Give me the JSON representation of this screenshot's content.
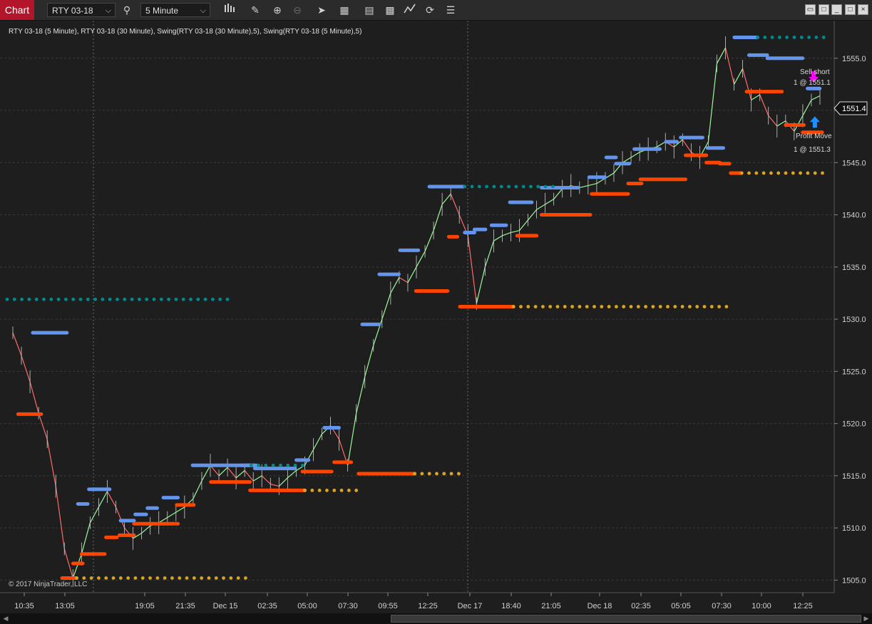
{
  "toolbar": {
    "tab_label": "Chart",
    "instrument": "RTY 03-18",
    "interval": "5 Minute",
    "icons": [
      "bars-type-icon",
      "pencil-icon",
      "zoom-in-icon",
      "zoom-out-icon",
      "pointer-icon",
      "data-box-icon",
      "layers-icon",
      "strategy-icon",
      "refresh-icon",
      "properties-icon"
    ],
    "window_icons": [
      "restore-icon",
      "maximize-icon",
      "minimize-icon",
      "window-icon",
      "close-icon"
    ]
  },
  "chart": {
    "legend_text": "RTY 03-18 (5 Minute), RTY 03-18 (30 Minute), Swing(RTY 03-18 (30 Minute),5), Swing(RTY 03-18 (5 Minute),5)",
    "copyright": "© 2017 NinjaTrader, LLC",
    "last_price_label": "1551.4",
    "annotations": [
      {
        "text": "Sell short",
        "kind": "entry"
      },
      {
        "text": "1 @ 1551.1",
        "kind": "entry-price"
      },
      {
        "text": "Profit Move",
        "kind": "exit"
      },
      {
        "text": "1 @ 1551.3",
        "kind": "exit-price"
      }
    ],
    "colors": {
      "background": "#1e1e1e",
      "grid": "#3a3a3a",
      "swing_high": "#6495ed",
      "swing_low": "#ff4500",
      "swing_high_dots": "#008b8b",
      "swing_low_dots": "#daa520",
      "candle_up": "#98fb98",
      "candle_down": "#ff6a6a",
      "sell_arrow": "#ff00ff",
      "buy_arrow": "#1e90ff"
    }
  },
  "chart_data": {
    "type": "line",
    "title": "",
    "x_tick_labels": [
      "10:35",
      "13:05",
      "19:05",
      "21:35",
      "Dec 15",
      "02:35",
      "05:00",
      "07:30",
      "09:55",
      "12:25",
      "Dec 17",
      "18:40",
      "21:05",
      "Dec 18",
      "02:35",
      "05:05",
      "07:30",
      "10:00",
      "12:25"
    ],
    "y_tick_labels": [
      "1505.0",
      "1510.0",
      "1515.0",
      "1520.0",
      "1525.0",
      "1530.0",
      "1535.0",
      "1540.0",
      "1545.0",
      "1550.0",
      "1555.0"
    ],
    "ylim": [
      1503.8,
      1558.6
    ],
    "series": [
      {
        "values_approx": [
          1528.7,
          1526.5,
          1524.0,
          1521.0,
          1518.5,
          1514.0,
          1508.0,
          1505.2,
          1507.5,
          1510.5,
          1512.0,
          1513.5,
          1512.0,
          1510.0,
          1509.0,
          1509.5,
          1510.2,
          1510.5,
          1511.0,
          1511.5,
          1512.0,
          1512.8,
          1514.5,
          1516.0,
          1515.0,
          1515.8,
          1514.8,
          1515.5,
          1514.5,
          1515.0,
          1514.2,
          1514.0,
          1514.8,
          1515.5,
          1516.0,
          1517.5,
          1519.0,
          1519.8,
          1518.5,
          1516.0,
          1521.0,
          1524.5,
          1527.5,
          1530.0,
          1532.5,
          1534.0,
          1533.5,
          1535.0,
          1536.5,
          1538.5,
          1541.0,
          1542.0,
          1540.0,
          1538.0,
          1531.5,
          1535.0,
          1537.5,
          1538.0,
          1538.3,
          1538.5,
          1539.5,
          1540.5,
          1541.0,
          1541.5,
          1542.5,
          1542.8,
          1542.6,
          1542.8,
          1543.0,
          1543.5,
          1544.0,
          1545.0,
          1545.5,
          1546.0,
          1546.3,
          1546.5,
          1547.0,
          1546.5,
          1547.2,
          1546.0,
          1545.5,
          1547.0,
          1554.5,
          1556.0,
          1552.5,
          1554.0,
          1551.0,
          1551.5,
          1549.5,
          1548.5,
          1549.0,
          1548.0,
          1549.5,
          1551.0,
          1551.4
        ]
      }
    ],
    "swing_highs": [
      {
        "x0": 10.5,
        "x1": 24.5,
        "y": 1528.7
      },
      {
        "x0": 29.0,
        "x1": 33.0,
        "y": 1512.3
      },
      {
        "x0": 33.5,
        "x1": 42.0,
        "y": 1513.7
      },
      {
        "x0": 46.5,
        "x1": 52.0,
        "y": 1510.7
      },
      {
        "x0": 52.5,
        "x1": 57.0,
        "y": 1511.3
      },
      {
        "x0": 57.5,
        "x1": 61.5,
        "y": 1511.9
      },
      {
        "x0": 64.0,
        "x1": 70.0,
        "y": 1512.9
      },
      {
        "x0": 76.0,
        "x1": 100.0,
        "y": 1516.0
      },
      {
        "x0": 96.0,
        "x1": 102.0,
        "y": 1516.0
      },
      {
        "x0": 101.5,
        "x1": 118.0,
        "y": 1515.7
      },
      {
        "x0": 118.5,
        "x1": 123.5,
        "y": 1516.5
      },
      {
        "x0": 130.0,
        "x1": 136.0,
        "y": 1519.6
      },
      {
        "x0": 145.5,
        "x1": 152.5,
        "y": 1529.5
      },
      {
        "x0": 152.5,
        "x1": 160.5,
        "y": 1534.3
      },
      {
        "x0": 161.0,
        "x1": 168.5,
        "y": 1536.6
      },
      {
        "x0": 173.0,
        "x1": 187.0,
        "y": 1542.7
      },
      {
        "x0": 187.5,
        "x1": 191.5,
        "y": 1538.3
      },
      {
        "x0": 191.5,
        "x1": 196.0,
        "y": 1538.6
      },
      {
        "x0": 198.5,
        "x1": 204.5,
        "y": 1539.0
      },
      {
        "x0": 206.0,
        "x1": 215.0,
        "y": 1541.2
      },
      {
        "x0": 219.0,
        "x1": 234.0,
        "y": 1542.6
      },
      {
        "x0": 238.5,
        "x1": 245.0,
        "y": 1543.6
      },
      {
        "x0": 245.5,
        "x1": 249.5,
        "y": 1545.5
      },
      {
        "x0": 249.5,
        "x1": 255.0,
        "y": 1544.9
      },
      {
        "x0": 257.0,
        "x1": 267.5,
        "y": 1546.3
      },
      {
        "x0": 270.0,
        "x1": 274.5,
        "y": 1547.0
      },
      {
        "x0": 276.0,
        "x1": 285.0,
        "y": 1547.4
      },
      {
        "x0": 287.0,
        "x1": 293.5,
        "y": 1546.4
      },
      {
        "x0": 298.0,
        "x1": 307.5,
        "y": 1557.0
      },
      {
        "x0": 304.0,
        "x1": 311.5,
        "y": 1555.3
      },
      {
        "x0": 311.5,
        "x1": 326.0,
        "y": 1555.0
      },
      {
        "x0": 328.0,
        "x1": 333.0,
        "y": 1552.1
      }
    ],
    "swing_lows": [
      {
        "x0": 4.5,
        "x1": 14.0,
        "y": 1520.9
      },
      {
        "x0": 22.5,
        "x1": 28.5,
        "y": 1505.2
      },
      {
        "x0": 27.0,
        "x1": 31.0,
        "y": 1506.6
      },
      {
        "x0": 30.5,
        "x1": 40.0,
        "y": 1507.5
      },
      {
        "x0": 40.5,
        "x1": 45.0,
        "y": 1509.1
      },
      {
        "x0": 46.0,
        "x1": 52.0,
        "y": 1509.3
      },
      {
        "x0": 52.0,
        "x1": 70.0,
        "y": 1510.4
      },
      {
        "x0": 69.5,
        "x1": 76.5,
        "y": 1512.2
      },
      {
        "x0": 83.5,
        "x1": 99.5,
        "y": 1514.4
      },
      {
        "x0": 99.5,
        "x1": 122.0,
        "y": 1513.6
      },
      {
        "x0": 121.0,
        "x1": 133.0,
        "y": 1515.4
      },
      {
        "x0": 134.0,
        "x1": 141.0,
        "y": 1516.3
      },
      {
        "x0": 144.0,
        "x1": 167.0,
        "y": 1515.2
      },
      {
        "x0": 167.5,
        "x1": 180.5,
        "y": 1532.7
      },
      {
        "x0": 181.0,
        "x1": 184.5,
        "y": 1537.9
      },
      {
        "x0": 185.5,
        "x1": 207.5,
        "y": 1531.2
      },
      {
        "x0": 209.0,
        "x1": 217.0,
        "y": 1538.0
      },
      {
        "x0": 219.0,
        "x1": 239.0,
        "y": 1540.0
      },
      {
        "x0": 239.5,
        "x1": 254.5,
        "y": 1542.0
      },
      {
        "x0": 254.5,
        "x1": 260.0,
        "y": 1543.0
      },
      {
        "x0": 259.5,
        "x1": 278.0,
        "y": 1543.4
      },
      {
        "x0": 278.0,
        "x1": 286.5,
        "y": 1545.7
      },
      {
        "x0": 286.5,
        "x1": 292.0,
        "y": 1545.0
      },
      {
        "x0": 292.0,
        "x1": 296.0,
        "y": 1544.9
      },
      {
        "x0": 296.5,
        "x1": 301.0,
        "y": 1544.0
      },
      {
        "x0": 303.0,
        "x1": 317.5,
        "y": 1551.8
      },
      {
        "x0": 319.0,
        "x1": 326.5,
        "y": 1548.6
      },
      {
        "x0": 326.0,
        "x1": 334.0,
        "y": 1547.9
      }
    ],
    "swing_high_dotted": [
      {
        "x0": 0.0,
        "x1": 93.0,
        "y": 1531.9
      },
      {
        "x0": 100.0,
        "x1": 122.0,
        "y": 1516.0
      },
      {
        "x0": 187.5,
        "x1": 225.0,
        "y": 1542.7
      },
      {
        "x0": 307.5,
        "x1": 336.0,
        "y": 1557.0
      }
    ],
    "swing_low_dotted": [
      {
        "x0": 28.5,
        "x1": 100.0,
        "y": 1505.2
      },
      {
        "x0": 122.0,
        "x1": 144.0,
        "y": 1513.6
      },
      {
        "x0": 167.0,
        "x1": 187.0,
        "y": 1515.2
      },
      {
        "x0": 207.5,
        "x1": 296.0,
        "y": 1531.2
      },
      {
        "x0": 301.0,
        "x1": 336.0,
        "y": 1544.0
      }
    ],
    "trade_markers": [
      {
        "type": "sell",
        "x": 330.5,
        "y": 1552.8
      },
      {
        "type": "buy",
        "x": 331.0,
        "y": 1549.3
      }
    ],
    "grid": true
  }
}
